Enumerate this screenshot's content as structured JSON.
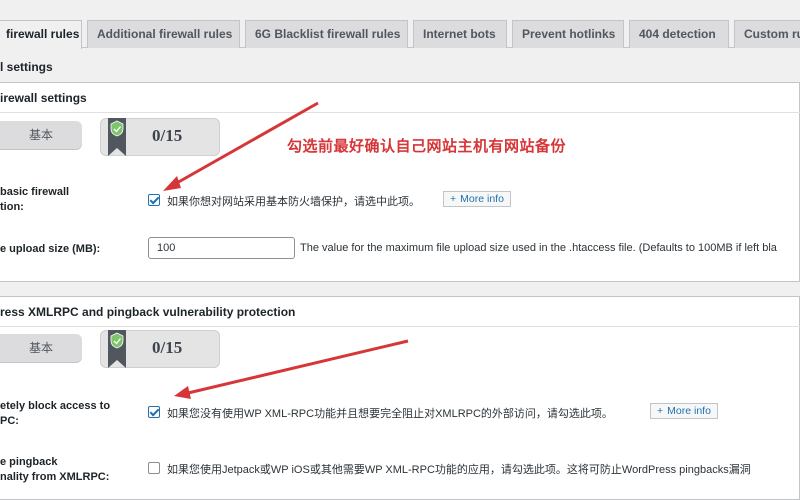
{
  "tabs": [
    {
      "label": "firewall rules",
      "active": true
    },
    {
      "label": "Additional firewall rules",
      "active": false
    },
    {
      "label": "6G Blacklist firewall rules",
      "active": false
    },
    {
      "label": "Internet bots",
      "active": false
    },
    {
      "label": "Prevent hotlinks",
      "active": false
    },
    {
      "label": "404 detection",
      "active": false
    },
    {
      "label": "Custom ru",
      "active": false
    }
  ],
  "section_title": "l settings",
  "basic_box": {
    "header": "irewall settings",
    "grade": "基本",
    "score": "0/15",
    "annotation": "勾选前最好确认自己网站主机有网站备份",
    "enable_label_line1": "basic firewall",
    "enable_label_line2": "tion:",
    "enable_checked": true,
    "enable_desc": "如果你想对网站采用基本防火墙保护，请选中此项。",
    "more_info": "More info",
    "upload_label": "e upload size (MB):",
    "upload_value": "100",
    "upload_desc": "The value for the maximum file upload size used in the .htaccess file. (Defaults to 100MB if left bla"
  },
  "xmlrpc_box": {
    "header": "ress XMLRPC and pingback vulnerability protection",
    "grade": "基本",
    "score": "0/15",
    "block_label_line1": "etely block access to",
    "block_label_line2": "PC:",
    "block_checked": true,
    "block_desc": "如果您没有使用WP XML-RPC功能并且想要完全阻止对XMLRPC的外部访问，请勾选此项。",
    "more_info": "More info",
    "pingback_label_line1": "e pingback",
    "pingback_label_line2": "nality from XMLRPC:",
    "pingback_checked": false,
    "pingback_desc": "如果您使用Jetpack或WP iOS或其他需要WP XML-RPC功能的应用，请勾选此项。这将可防止WordPress pingbacks漏洞"
  },
  "colors": {
    "annotation_red": "#d63638",
    "link_blue": "#2271b1",
    "ribbon_gray": "#50575e",
    "shield_green": "#7ec46a"
  }
}
